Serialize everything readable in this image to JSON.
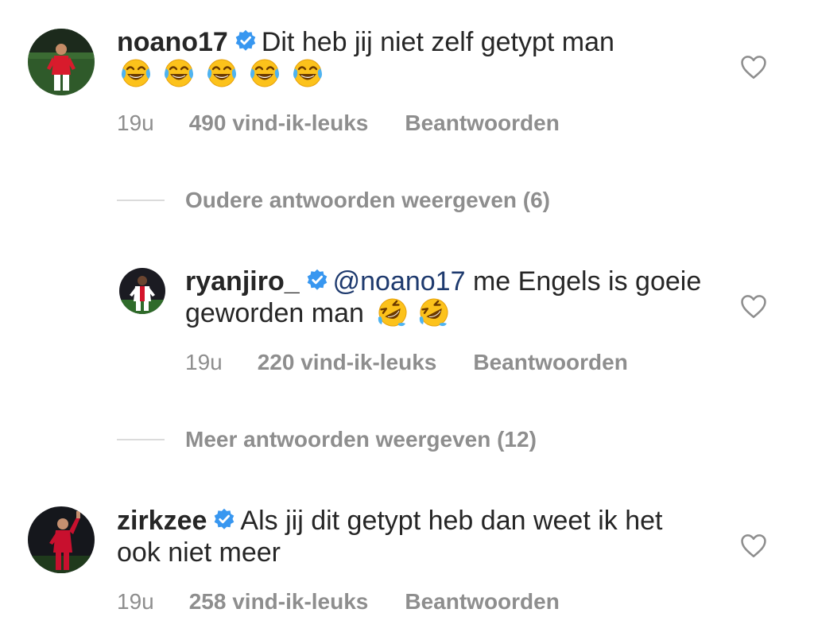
{
  "colors": {
    "text": "#262626",
    "muted": "#8e8e8e",
    "mention": "#1e3a6e",
    "verified": "#3897f0",
    "divider": "#dbdbdb"
  },
  "comments": [
    {
      "username": "noano17",
      "verified": true,
      "text": "Dit heb jij niet zelf getypt man",
      "emojis": [
        "face-with-tears-of-joy",
        "face-with-tears-of-joy",
        "face-with-tears-of-joy",
        "face-with-tears-of-joy",
        "face-with-tears-of-joy"
      ],
      "time": "19u",
      "likes": "490 vind-ik-leuks",
      "reply_label": "Beantwoorden"
    },
    {
      "username": "ryanjiro_",
      "verified": true,
      "mention": "@noano17",
      "text": " me Engels is goeie geworden man",
      "emojis": [
        "rolling-on-the-floor-laughing",
        "rolling-on-the-floor-laughing"
      ],
      "time": "19u",
      "likes": "220 vind-ik-leuks",
      "reply_label": "Beantwoorden"
    },
    {
      "username": "zirkzee",
      "verified": true,
      "text": "Als jij dit getypt heb dan weet ik het ook niet meer",
      "time": "19u",
      "likes": "258 vind-ik-leuks",
      "reply_label": "Beantwoorden"
    }
  ],
  "thread_toggles": {
    "older": "Oudere antwoorden weergeven (6)",
    "more": "Meer antwoorden weergeven (12)"
  }
}
